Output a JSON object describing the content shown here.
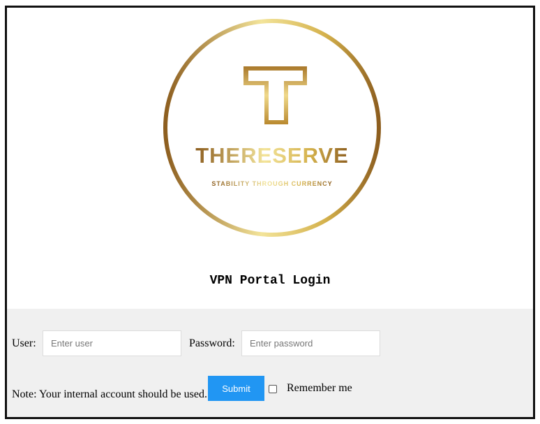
{
  "logo": {
    "brand": "THERESERVE",
    "tagline": "STABILITY THROUGH CURRENCY",
    "icon": "letter-t-monogram-icon",
    "colors": {
      "gold_light": "#f3e49a",
      "gold_mid": "#d4b14c",
      "gold_dark": "#8d5e1f"
    }
  },
  "title": "VPN Portal Login",
  "form": {
    "user_label": "User:",
    "user_placeholder": "Enter user",
    "password_label": "Password:",
    "password_placeholder": "Enter password",
    "note": "Note: Your internal account should be used.",
    "submit_label": "Submit",
    "remember_label": "Remember me"
  },
  "colors": {
    "button": "#2196f3",
    "panel": "#f0f0f0"
  }
}
